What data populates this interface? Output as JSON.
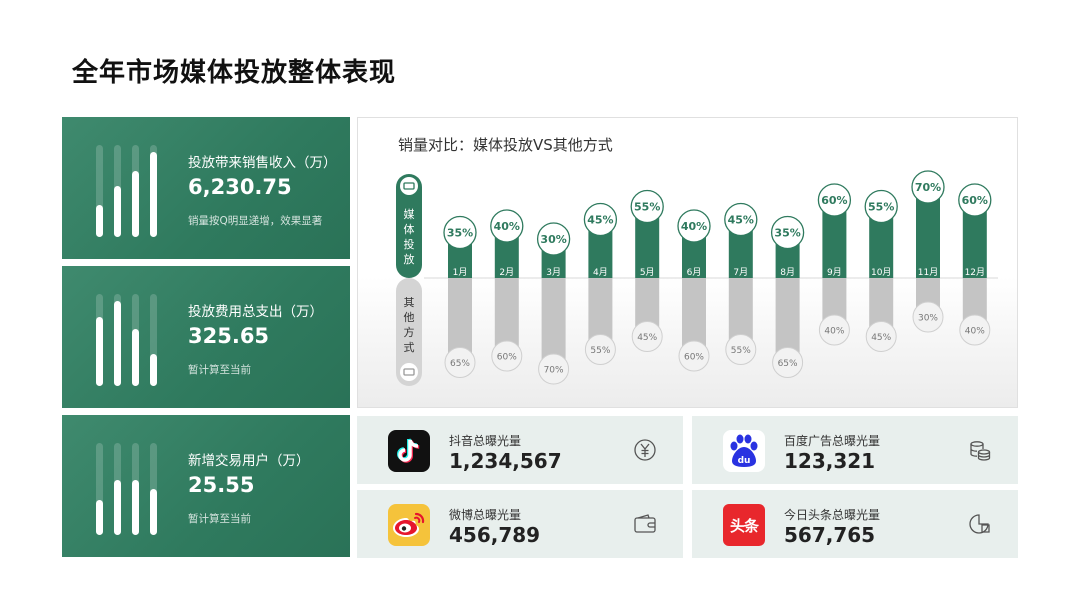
{
  "page": {
    "title": "全年市场媒体投放整体表现"
  },
  "kpis": [
    {
      "label": "投放带来销售收入（万）",
      "value": "6,230.75",
      "note": "销量按Q明显递增，效果显著",
      "bars": [
        0.35,
        0.55,
        0.72,
        0.92
      ]
    },
    {
      "label": "投放费用总支出（万）",
      "value": "325.65",
      "note": "暂计算至当前",
      "bars": [
        0.75,
        0.92,
        0.62,
        0.35
      ]
    },
    {
      "label": "新增交易用户（万）",
      "value": "25.55",
      "note": "暂计算至当前",
      "bars": [
        0.38,
        0.6,
        0.6,
        0.5
      ]
    }
  ],
  "chart_data": {
    "type": "bar",
    "title": "销量对比：媒体投放VS其他方式",
    "categories": [
      "1月",
      "2月",
      "3月",
      "4月",
      "5月",
      "6月",
      "7月",
      "8月",
      "9月",
      "10月",
      "11月",
      "12月"
    ],
    "series": [
      {
        "name": "媒体投放",
        "values": [
          35,
          40,
          30,
          45,
          55,
          40,
          45,
          35,
          60,
          55,
          70,
          60
        ],
        "labels": [
          "35%",
          "40%",
          "30%",
          "45%",
          "55%",
          "40%",
          "45%",
          "35%",
          "60%",
          "55%",
          "70%",
          "60%"
        ],
        "color": "#2f7a5e"
      },
      {
        "name": "其他方式",
        "values": [
          65,
          60,
          70,
          55,
          45,
          60,
          55,
          65,
          40,
          45,
          30,
          40
        ],
        "labels": [
          "65%",
          "60%",
          "70%",
          "55%",
          "45%",
          "60%",
          "55%",
          "65%",
          "40%",
          "45%",
          "30%",
          "40%"
        ],
        "color": "#c4c4c4"
      }
    ],
    "ylim": [
      0,
      100
    ],
    "legend": "left-vertical"
  },
  "platforms": [
    {
      "label": "抖音总曝光量",
      "value": "1,234,567",
      "logo": "tiktok-logo",
      "icon": "yuan-icon"
    },
    {
      "label": "百度广告总曝光量",
      "value": "123,321",
      "logo": "baidu-logo",
      "icon": "coins-icon"
    },
    {
      "label": "微博总曝光量",
      "value": "456,789",
      "logo": "weibo-logo",
      "icon": "wallet-icon"
    },
    {
      "label": "今日头条总曝光量",
      "value": "567,765",
      "logo": "toutiao-logo",
      "logo_text": "头条",
      "icon": "pie-chart-icon"
    }
  ],
  "colors": {
    "accent": "#2f7a5e",
    "secondary": "#c4c4c4",
    "tile_bg": "#e8efed"
  }
}
